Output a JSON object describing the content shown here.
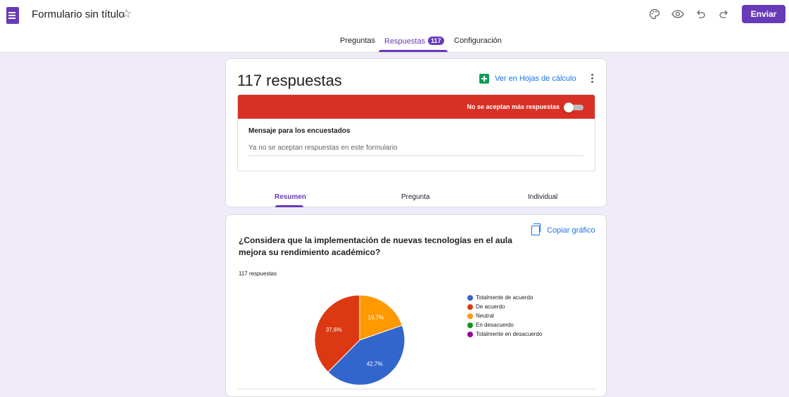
{
  "header": {
    "title": "Formulario sin título",
    "send_label": "Enviar",
    "tabs": [
      {
        "label": "Preguntas"
      },
      {
        "label": "Respuestas",
        "badge": "117"
      },
      {
        "label": "Configuración"
      }
    ],
    "accent": "#673ab7"
  },
  "summary": {
    "count_label": "117 respuestas",
    "sheets_label": "Ver en Hojas de cálculo",
    "closed_banner": "No se aceptan más respuestas",
    "message_label": "Mensaje para los encuestados",
    "message_value": "Ya no se aceptan respuestas en este formulario",
    "subtabs": [
      {
        "label": "Resumen"
      },
      {
        "label": "Pregunta"
      },
      {
        "label": "Individual"
      }
    ]
  },
  "question": {
    "title": "¿Considera que la implementación de nuevas tecnologías en el aula mejora su rendimiento académico?",
    "copy_label": "Copiar gráfico",
    "count_label": "117 respuestas"
  },
  "chart_data": {
    "type": "pie",
    "categories": [
      "Totalmente de acuerdo",
      "De acuerdo",
      "Neutral",
      "En desacuerdo",
      "Totalmente en desacuerdo"
    ],
    "values": [
      42.7,
      37.6,
      19.7,
      0,
      0
    ],
    "labels": [
      "42,7%",
      "37,6%",
      "19,7%",
      "",
      ""
    ],
    "colors": [
      "#3366cc",
      "#dc3912",
      "#ff9900",
      "#109618",
      "#990099"
    ],
    "legend": "right"
  }
}
